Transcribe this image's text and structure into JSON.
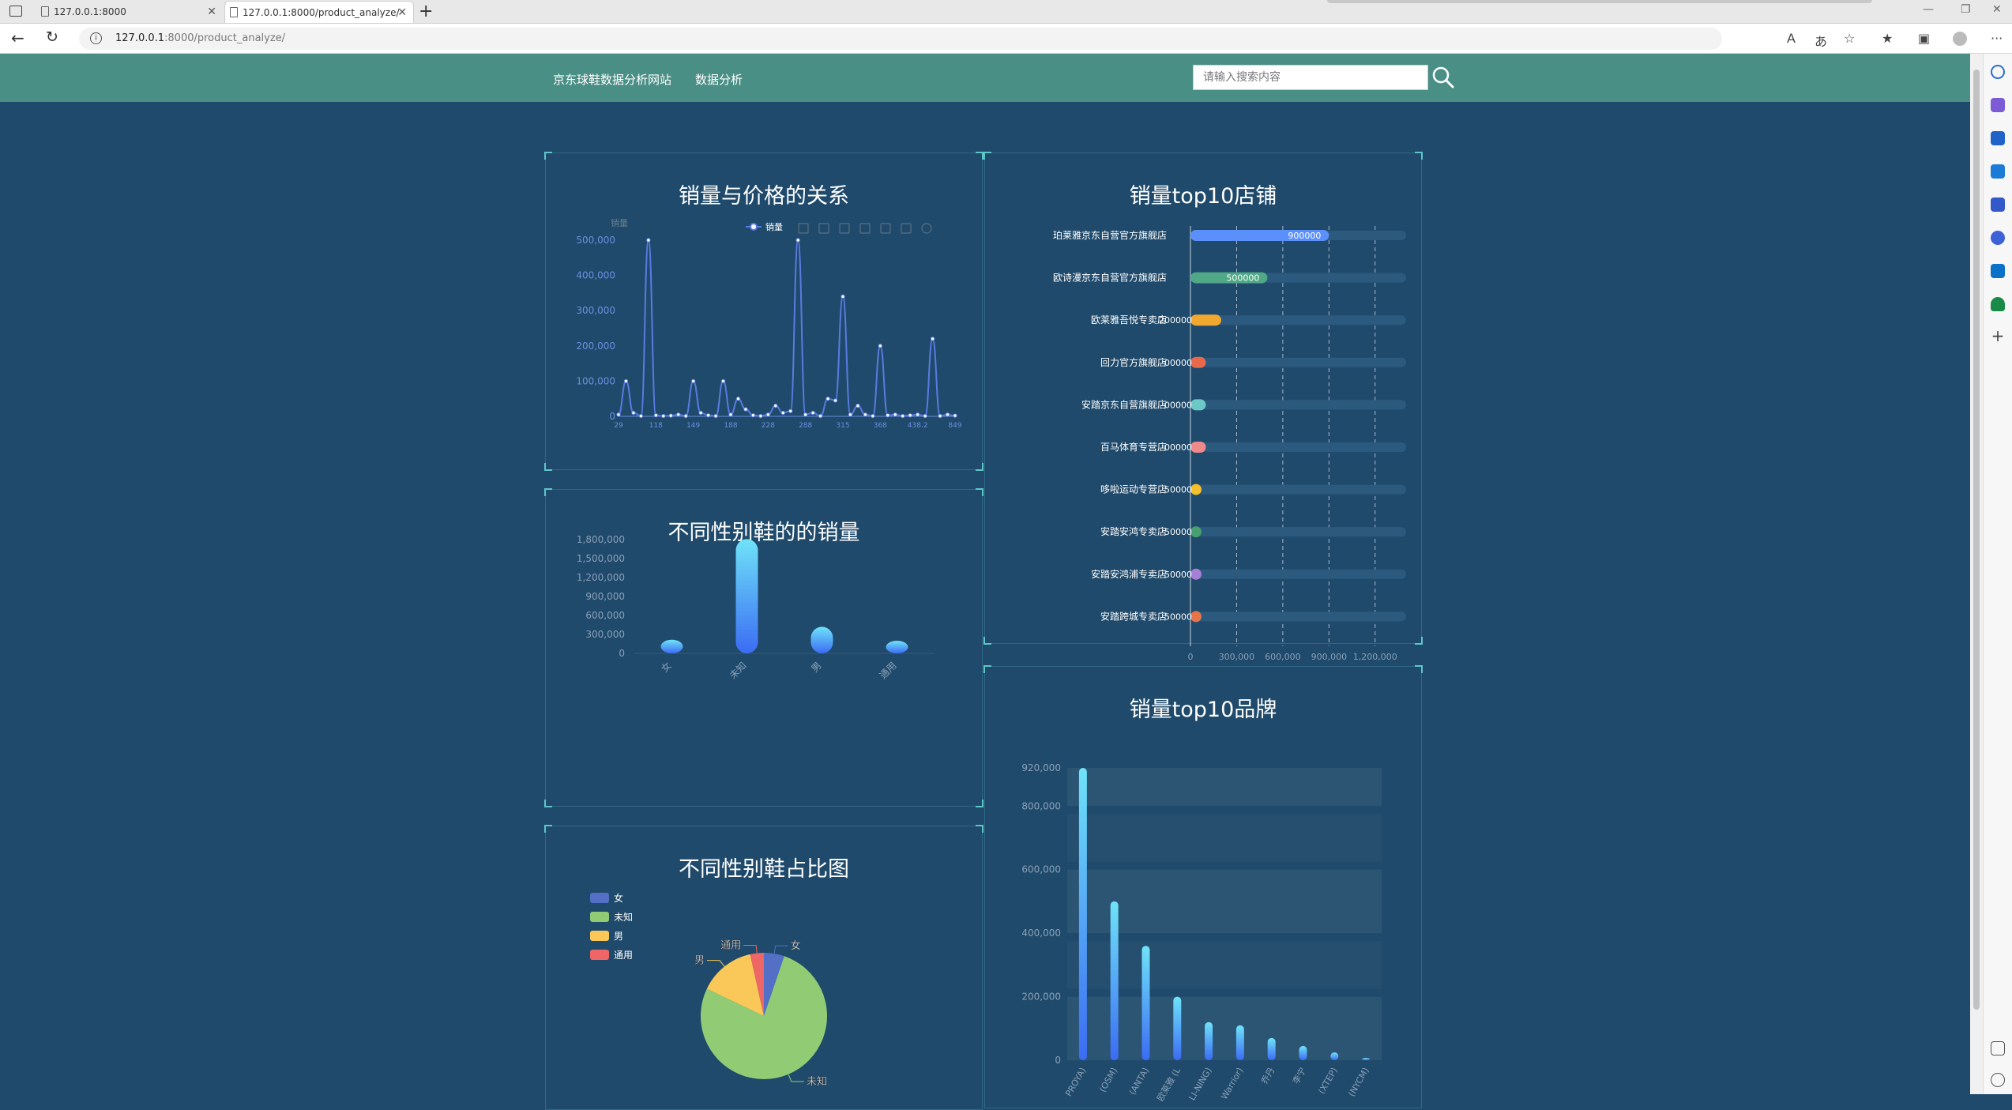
{
  "browser": {
    "tabs": [
      {
        "label": "127.0.0.1:8000"
      },
      {
        "label": "127.0.0.1:8000/product_analyze/"
      }
    ],
    "url_host": "127.0.0.1",
    "url_rest": ":8000/product_analyze/"
  },
  "header": {
    "nav": [
      "京东球鞋数据分析网站",
      "数据分析"
    ],
    "search_placeholder": "请输入搜索内容"
  },
  "colors": {
    "header_bg": "#4a8f86",
    "page_bg": "#1f4a6b",
    "accent_corner": "#5fc6c6"
  },
  "panels": {
    "price_sales": {
      "title": "销量与价格的关系"
    },
    "gender_sales": {
      "title": "不同性别鞋的的销量"
    },
    "gender_share": {
      "title": "不同性别鞋占比图"
    },
    "top_stores": {
      "title": "销量top10店铺"
    },
    "top_brands": {
      "title": "销量top10品牌"
    }
  },
  "chart_data": [
    {
      "id": "price_sales",
      "type": "line",
      "title": "销量与价格的关系",
      "ylabel": "销量",
      "legend": [
        "销量"
      ],
      "legend_position": "top-right",
      "ylim": [
        0,
        500000
      ],
      "y_ticks": [
        "500,000",
        "400,000",
        "300,000",
        "200,000",
        "100,000",
        "0"
      ],
      "x_ticks": [
        "29",
        "118",
        "149",
        "188",
        "228",
        "288",
        "315",
        "368",
        "438.2",
        "849"
      ],
      "values": [
        5000,
        100000,
        10000,
        1000,
        500000,
        3000,
        1000,
        2000,
        5000,
        1000,
        100000,
        10000,
        3000,
        1000,
        100000,
        5000,
        50000,
        20000,
        3000,
        1000,
        5000,
        30000,
        10000,
        15000,
        500000,
        5000,
        10000,
        1000,
        50000,
        45000,
        340000,
        5000,
        30000,
        5000,
        1000,
        200000,
        3000,
        5000,
        1000,
        3000,
        5000,
        1000,
        220000,
        1000,
        5000,
        2000
      ]
    },
    {
      "id": "gender_sales",
      "type": "bar",
      "title": "不同性别鞋的的销量",
      "categories": [
        "女",
        "未知",
        "男",
        "通用"
      ],
      "values": [
        120000,
        1760000,
        330000,
        80000
      ],
      "ylim": [
        0,
        1800000
      ],
      "y_ticks": [
        "1,800,000",
        "1,500,000",
        "1,200,000",
        "900,000",
        "600,000",
        "300,000",
        "0"
      ]
    },
    {
      "id": "gender_share",
      "type": "pie",
      "title": "不同性别鞋占比图",
      "categories": [
        "女",
        "未知",
        "男",
        "通用"
      ],
      "values": [
        120000,
        1760000,
        330000,
        80000
      ],
      "colors": [
        "#5470c6",
        "#91cc75",
        "#fac858",
        "#ee6666"
      ],
      "legend_position": "top-left",
      "outside_labels": [
        "女",
        "未知",
        "男",
        "通用"
      ]
    },
    {
      "id": "top_stores",
      "type": "bar",
      "orientation": "horizontal",
      "title": "销量top10店铺",
      "categories": [
        "珀莱雅京东自营官方旗舰店",
        "欧诗漫京东自营官方旗舰店",
        "欧莱雅吾悦专卖店",
        "回力官方旗舰店",
        "安踏京东自营旗舰店",
        "百马体育专营店",
        "哆啦运动专营店",
        "安踏安鸿专卖店",
        "安踏安鸿浦专卖店",
        "安踏跨城专卖店"
      ],
      "values": [
        900000,
        500000,
        200000,
        100000,
        100000,
        100000,
        50000,
        50000,
        50000,
        50000
      ],
      "value_labels": [
        "900000",
        "500000",
        "200000",
        "00000",
        "00000",
        "00000",
        "50000",
        "50000",
        "50000",
        "50000"
      ],
      "bar_colors": [
        "#5b8ff9",
        "#4fa886",
        "#f0a830",
        "#e8684a",
        "#6dc8c8",
        "#f08a8a",
        "#f6c02c",
        "#47a06f",
        "#a87fd6",
        "#e8744a"
      ],
      "xlim": [
        0,
        1350000
      ],
      "x_ticks": [
        "0",
        "300,000",
        "600,000",
        "900,000",
        "1,200,000"
      ]
    },
    {
      "id": "top_brands",
      "type": "bar",
      "title": "销量top10品牌",
      "categories": [
        "PROYA)",
        "(OSM)",
        "(ANTA)",
        "欧莱雅 (L",
        "LI-NING)",
        "Warrior)",
        "乔丹",
        "李宁",
        "(XTEP)",
        "(NYCM)"
      ],
      "values": [
        920000,
        500000,
        360000,
        200000,
        120000,
        110000,
        70000,
        45000,
        25000,
        5000
      ],
      "ylim": [
        0,
        920000
      ],
      "y_ticks": [
        "920,000",
        "800,000",
        "600,000",
        "400,000",
        "200,000",
        "0"
      ]
    }
  ]
}
